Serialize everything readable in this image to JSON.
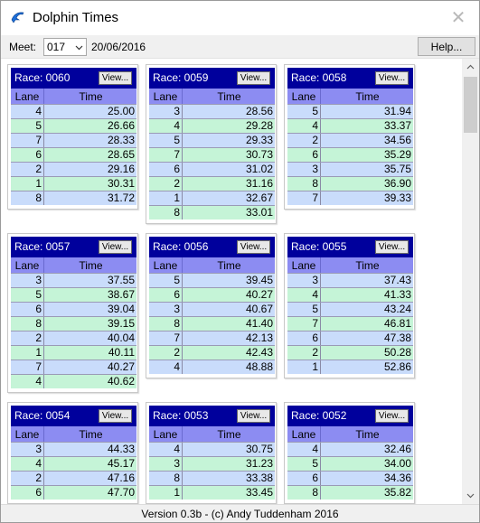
{
  "window": {
    "title": "Dolphin Times",
    "close_glyph": "✕"
  },
  "toolbar": {
    "meet_label": "Meet:",
    "meet_value": "017",
    "meet_date": "20/06/2016",
    "help_label": "Help..."
  },
  "status": {
    "text": "Version 0.3b - (c) Andy Tuddenham 2016"
  },
  "columns": {
    "lane": "Lane",
    "time": "Time"
  },
  "view_label": "View...",
  "races": [
    {
      "name": "Race: 0060",
      "rows": [
        [
          "4",
          "25.00"
        ],
        [
          "5",
          "26.66"
        ],
        [
          "7",
          "28.33"
        ],
        [
          "6",
          "28.65"
        ],
        [
          "2",
          "29.16"
        ],
        [
          "1",
          "30.31"
        ],
        [
          "8",
          "31.72"
        ]
      ]
    },
    {
      "name": "Race: 0059",
      "rows": [
        [
          "3",
          "28.56"
        ],
        [
          "4",
          "29.28"
        ],
        [
          "5",
          "29.33"
        ],
        [
          "7",
          "30.73"
        ],
        [
          "6",
          "31.02"
        ],
        [
          "2",
          "31.16"
        ],
        [
          "1",
          "32.67"
        ],
        [
          "8",
          "33.01"
        ]
      ]
    },
    {
      "name": "Race: 0058",
      "rows": [
        [
          "5",
          "31.94"
        ],
        [
          "4",
          "33.37"
        ],
        [
          "2",
          "34.56"
        ],
        [
          "6",
          "35.29"
        ],
        [
          "3",
          "35.75"
        ],
        [
          "8",
          "36.90"
        ],
        [
          "7",
          "39.33"
        ]
      ]
    },
    {
      "name": "Race: 0057",
      "rows": [
        [
          "3",
          "37.55"
        ],
        [
          "5",
          "38.67"
        ],
        [
          "6",
          "39.04"
        ],
        [
          "8",
          "39.15"
        ],
        [
          "2",
          "40.04"
        ],
        [
          "1",
          "40.11"
        ],
        [
          "7",
          "40.27"
        ],
        [
          "4",
          "40.62"
        ]
      ]
    },
    {
      "name": "Race: 0056",
      "rows": [
        [
          "5",
          "39.45"
        ],
        [
          "6",
          "40.27"
        ],
        [
          "3",
          "40.67"
        ],
        [
          "8",
          "41.40"
        ],
        [
          "7",
          "42.13"
        ],
        [
          "2",
          "42.43"
        ],
        [
          "4",
          "48.88"
        ]
      ]
    },
    {
      "name": "Race: 0055",
      "rows": [
        [
          "3",
          "37.43"
        ],
        [
          "4",
          "41.33"
        ],
        [
          "5",
          "43.24"
        ],
        [
          "7",
          "46.81"
        ],
        [
          "6",
          "47.38"
        ],
        [
          "2",
          "50.28"
        ],
        [
          "1",
          "52.86"
        ]
      ]
    },
    {
      "name": "Race: 0054",
      "rows": [
        [
          "3",
          "44.33"
        ],
        [
          "4",
          "45.17"
        ],
        [
          "2",
          "47.16"
        ],
        [
          "6",
          "47.70"
        ]
      ]
    },
    {
      "name": "Race: 0053",
      "rows": [
        [
          "4",
          "30.75"
        ],
        [
          "3",
          "31.23"
        ],
        [
          "8",
          "33.38"
        ],
        [
          "1",
          "33.45"
        ]
      ]
    },
    {
      "name": "Race: 0052",
      "rows": [
        [
          "4",
          "32.46"
        ],
        [
          "5",
          "34.00"
        ],
        [
          "6",
          "34.36"
        ],
        [
          "8",
          "35.82"
        ]
      ]
    }
  ]
}
